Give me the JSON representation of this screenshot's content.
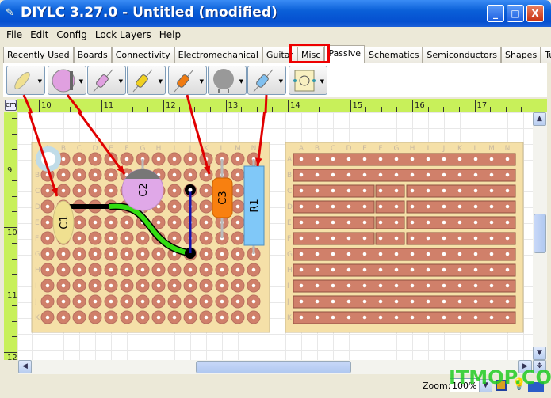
{
  "window": {
    "title": "DIYLC 3.27.0 - Untitled  (modified)",
    "minimize": "_",
    "maximize": "□",
    "close": "X"
  },
  "menu": [
    "File",
    "Edit",
    "Config",
    "Lock Layers",
    "Help"
  ],
  "tabs": [
    "Recently Used",
    "Boards",
    "Connectivity",
    "Electromechanical",
    "Guitar",
    "Misc",
    "Passive",
    "Schematics",
    "Semiconductors",
    "Shapes",
    "Tubes"
  ],
  "active_tab": "Passive",
  "toolbar_items": [
    "ceramic-capacitor-icon",
    "electrolytic-capacitor-icon",
    "film-capacitor-pink-icon",
    "film-capacitor-yellow-icon",
    "film-capacitor-orange-icon",
    "potentiometer-icon",
    "resistor-icon",
    "trimmer-potentiometer-icon"
  ],
  "ruler": {
    "unit": "cm",
    "top": [
      "10",
      "11",
      "12",
      "13",
      "14",
      "15",
      "16",
      "17"
    ],
    "left": [
      "9",
      "10",
      "11",
      "12"
    ]
  },
  "board_columns": [
    "A",
    "B",
    "C",
    "D",
    "E",
    "F",
    "G",
    "H",
    "I",
    "J",
    "K",
    "L",
    "M",
    "N"
  ],
  "board_rows": [
    "A",
    "B",
    "C",
    "D",
    "E",
    "F",
    "G",
    "H",
    "I",
    "J",
    "K"
  ],
  "components": {
    "c1": "C1",
    "c2": "C2",
    "c3": "C3",
    "r1": "R1"
  },
  "colors": {
    "highlight": "#e00000",
    "ruler": "#c8f05a",
    "board": "#f5e0a8",
    "pad": "#d0806a",
    "wire_green": "#33dd11",
    "wire_blue": "#1010b0"
  },
  "status": {
    "zoom_label": "Zoom:",
    "zoom_value": "100%"
  },
  "watermark": "ITMOP.COM"
}
